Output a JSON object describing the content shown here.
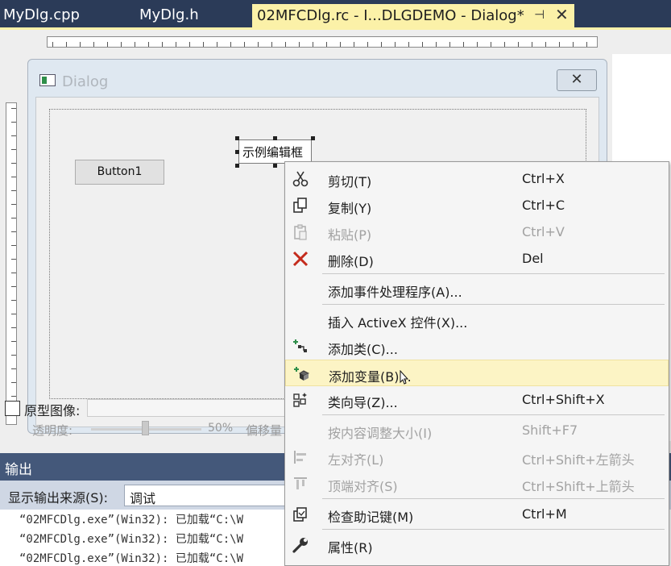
{
  "tabs": {
    "tab1": "MyDlg.cpp",
    "tab2": "MyDlg.h",
    "active": "02MFCDlg.rc - I...DLGDEMO - Dialog*",
    "pin_icon": "pin-icon",
    "close_icon": "close-icon"
  },
  "dialog": {
    "title": "Dialog",
    "close_glyph": "✕",
    "button1": "Button1",
    "edit_text": "示例编辑框"
  },
  "prototype": {
    "label": "原型图像:",
    "opacity_label": "透明度:",
    "opacity_value": "50%",
    "opacity_level": 0.5,
    "offset_label": "偏移量"
  },
  "output": {
    "title": "输出",
    "source_label": "显示输出来源(S):",
    "source_value": "调试",
    "lines": [
      "“02MFCDlg.exe”(Win32): 已加载“C:\\W",
      "“02MFCDlg.exe”(Win32): 已加载“C:\\W",
      "“02MFCDlg.exe”(Win32): 已加载“C:\\W"
    ]
  },
  "menu": {
    "cut": {
      "label": "剪切(T)",
      "shortcut": "Ctrl+X",
      "icon": "scissors-icon"
    },
    "copy": {
      "label": "复制(Y)",
      "shortcut": "Ctrl+C",
      "icon": "copy-icon"
    },
    "paste": {
      "label": "粘贴(P)",
      "shortcut": "Ctrl+V",
      "icon": "paste-icon"
    },
    "delete": {
      "label": "删除(D)",
      "shortcut": "Del",
      "icon": "delete-x-icon"
    },
    "add_event": {
      "label": "添加事件处理程序(A)..."
    },
    "insert_activex": {
      "label": "插入 ActiveX 控件(X)..."
    },
    "add_class": {
      "label": "添加类(C)...",
      "icon": "add-class-icon"
    },
    "add_variable": {
      "label": "添加变量(B)...",
      "icon": "add-variable-icon"
    },
    "class_wizard": {
      "label": "类向导(Z)...",
      "shortcut": "Ctrl+Shift+X",
      "icon": "class-wizard-icon"
    },
    "size_to_content": {
      "label": "按内容调整大小(I)",
      "shortcut": "Shift+F7"
    },
    "align_left": {
      "label": "左对齐(L)",
      "shortcut": "Ctrl+Shift+左箭头",
      "icon": "align-left-icon"
    },
    "align_top": {
      "label": "顶端对齐(S)",
      "shortcut": "Ctrl+Shift+上箭头",
      "icon": "align-top-icon"
    },
    "check_mnemonics": {
      "label": "检查助记键(M)",
      "shortcut": "Ctrl+M",
      "icon": "check-mnemonics-icon"
    },
    "properties": {
      "label": "属性(R)",
      "icon": "wrench-icon"
    }
  },
  "colors": {
    "tab_bar": "#2b3b58",
    "active_tab": "#fbf1a8",
    "output_title": "#44587a",
    "highlight": "#fcf4c5",
    "delete_icon": "#c42b1c"
  }
}
